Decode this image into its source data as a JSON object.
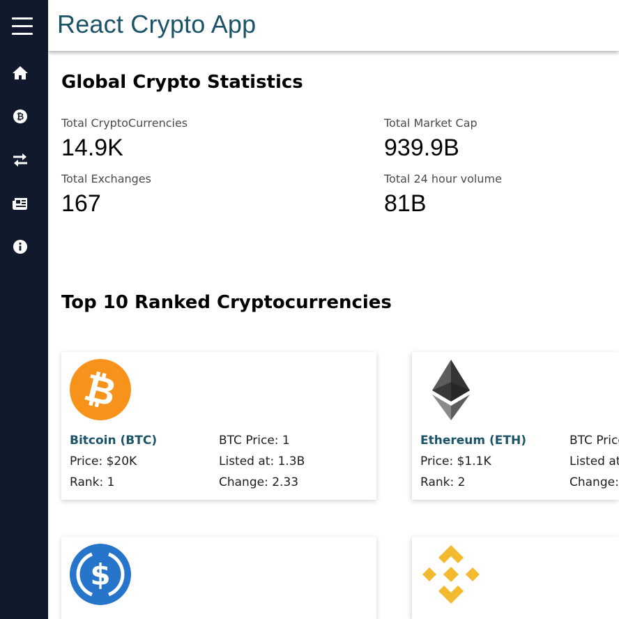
{
  "app": {
    "title": "React Crypto App"
  },
  "sidebar": {
    "items": [
      {
        "icon": "home-icon"
      },
      {
        "icon": "bitcoin-icon"
      },
      {
        "icon": "exchange-arrows-icon"
      },
      {
        "icon": "news-icon"
      },
      {
        "icon": "info-icon"
      }
    ]
  },
  "stats": {
    "heading": "Global Crypto Statistics",
    "total_cryptocurrencies": {
      "label": "Total CryptoCurrencies",
      "value": "14.9K"
    },
    "total_market_cap": {
      "label": "Total Market Cap",
      "value": "939.9B"
    },
    "total_exchanges": {
      "label": "Total Exchanges",
      "value": "167"
    },
    "total_24h_volume": {
      "label": "Total 24 hour volume",
      "value": "81B"
    }
  },
  "top10": {
    "heading": "Top 10 Ranked Cryptocurrencies",
    "coins": [
      {
        "name": "Bitcoin (BTC)",
        "price": "Price: $20K",
        "rank": "Rank: 1",
        "btc_price": "BTC Price: 1",
        "listed_at": "Listed at: 1.3B",
        "change": "Change: 2.33",
        "logo": "bitcoin-logo",
        "color": "#f7931a"
      },
      {
        "name": "Ethereum (ETH)",
        "price": "Price: $1.1K",
        "rank": "Rank: 2",
        "btc_price": "BTC Price:",
        "listed_at": "Listed at:",
        "change": "Change:",
        "logo": "ethereum-logo",
        "color": "#343434"
      },
      {
        "logo": "usd-coin-logo",
        "color": "#2775ca"
      },
      {
        "logo": "binance-coin-logo",
        "color": "#f3ba2f"
      }
    ]
  },
  "colors": {
    "sidebar": "#111a2c",
    "accent": "#1a5368"
  }
}
